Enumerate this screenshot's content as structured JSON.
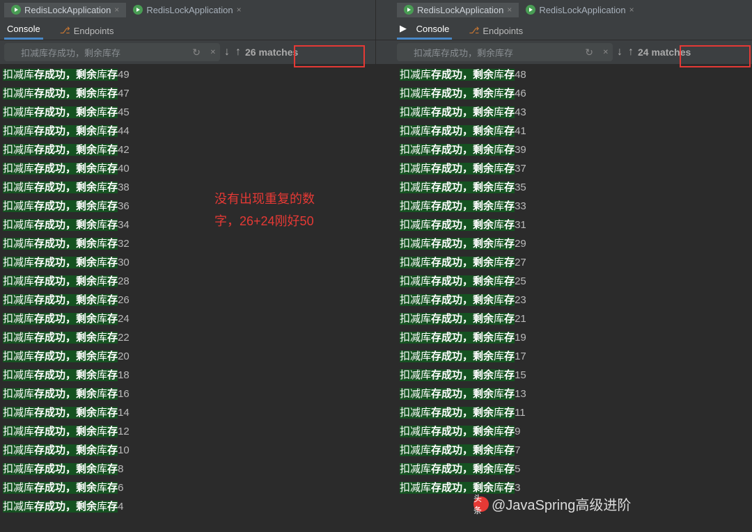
{
  "tabs_left": [
    {
      "label": "RedisLockApplication",
      "active": true
    },
    {
      "label": "RedisLockApplication",
      "active": false
    }
  ],
  "tabs_right": [
    {
      "label": "RedisLockApplication",
      "active": true
    },
    {
      "label": "RedisLockApplication",
      "active": false
    }
  ],
  "tool_tabs": {
    "console": "Console",
    "endpoints": "Endpoints"
  },
  "search": {
    "placeholder": "扣减库存成功，剩余库存"
  },
  "matches_left": "26 matches",
  "matches_right": "24 matches",
  "log_prefix": {
    "p1": "扣减库",
    "p2": "存成功，剩余",
    "p3": "库",
    "p4": "存"
  },
  "left_values": [
    49,
    47,
    45,
    44,
    42,
    40,
    38,
    36,
    34,
    32,
    30,
    28,
    26,
    24,
    22,
    20,
    18,
    16,
    14,
    12,
    10,
    8,
    6,
    4
  ],
  "right_values": [
    48,
    46,
    43,
    41,
    39,
    37,
    35,
    33,
    31,
    29,
    27,
    25,
    23,
    21,
    19,
    17,
    15,
    13,
    11,
    9,
    7,
    5,
    3
  ],
  "annotation": {
    "l1": "没有出现重复的数",
    "l2": "字，26+24刚好50"
  },
  "watermark": {
    "badge": "头条",
    "text": "@JavaSpring高级进阶"
  }
}
